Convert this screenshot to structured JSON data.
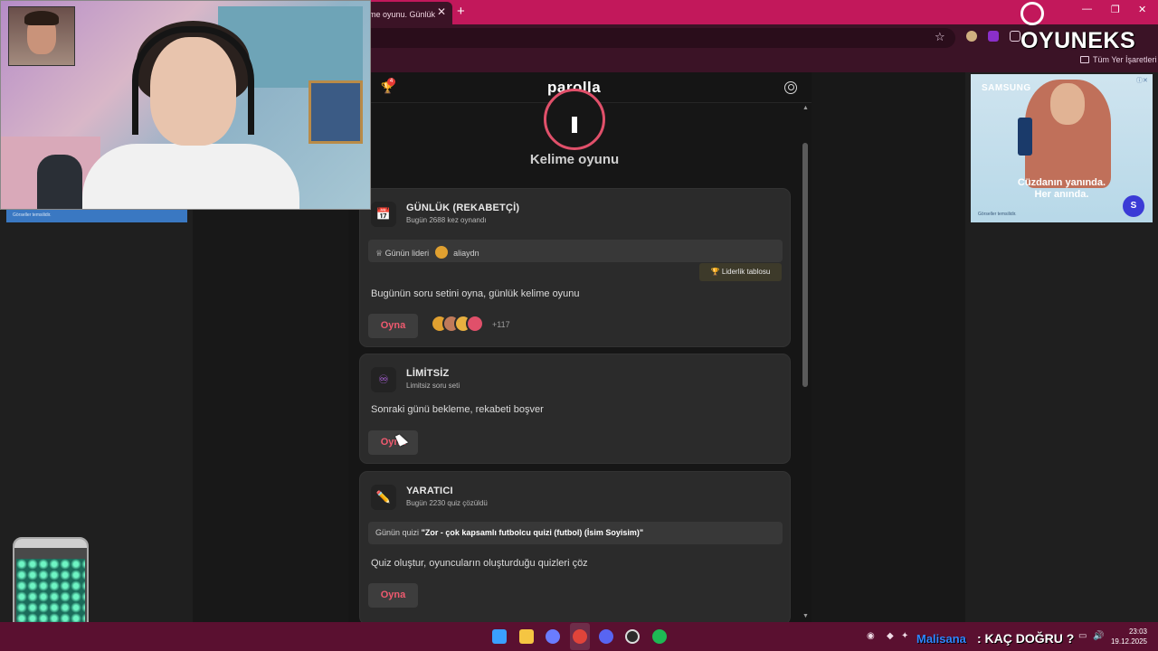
{
  "browser": {
    "tab_title": "me oyunu. Günlük",
    "tab_close": "✕",
    "new_tab": "+",
    "window_controls": [
      "—",
      "❐",
      "✕"
    ],
    "bookmark_folder": "Tüm Yer İşaretleri",
    "star": "☆"
  },
  "app": {
    "logo": "parolla",
    "notification_count": "4",
    "section_title": "Kelime oyunu",
    "cards": {
      "daily": {
        "icon": "📅",
        "title": "GÜNLÜK (REKABETÇİ)",
        "subtitle": "Bugün 2688 kez oynandı",
        "leader_label": "Günün lideri",
        "leader_name": "aliaydn",
        "leaderboard_button": "🏆 Liderlik tablosu",
        "description": "Bugünün soru setini oyna, günlük kelime oyunu",
        "play": "Oyna",
        "players_more": "+117"
      },
      "unlimited": {
        "icon": "♾",
        "title": "LİMİTSİZ",
        "subtitle": "Limitsiz soru seti",
        "description": "Sonraki günü bekleme, rekabeti boşver",
        "play": "Oyna"
      },
      "creator": {
        "icon": "✏️",
        "title": "YARATICI",
        "subtitle": "Bugün 2230 quiz çözüldü",
        "quiz_label": "Günün quizi",
        "quiz_name": "\"Zor - çok kapsamlı futbolcu quizi (futbol) (İsim Soyisim)\"",
        "description": "Quiz oluştur, oyuncuların oluşturduğu quizleri çöz",
        "play": "Oyna"
      }
    }
  },
  "ads": {
    "right_brand": "SAMSUNG",
    "right_tagline_1": "Cüzdanın yanında.",
    "right_tagline_2": "Her anında.",
    "right_small": "Görseller temsilidir.",
    "left_small": "Görseller temsilidir."
  },
  "overlay": {
    "brand": "OYUNEKS",
    "chat_user": "Malisana",
    "chat_message": ": KAÇ DOĞRU ?"
  },
  "taskbar": {
    "time": "23:03",
    "date": "19.12.2025"
  },
  "colors": {
    "accent": "#ef5a6f",
    "tabbar": "#c2185b",
    "card_bg": "#2b2b2b"
  }
}
